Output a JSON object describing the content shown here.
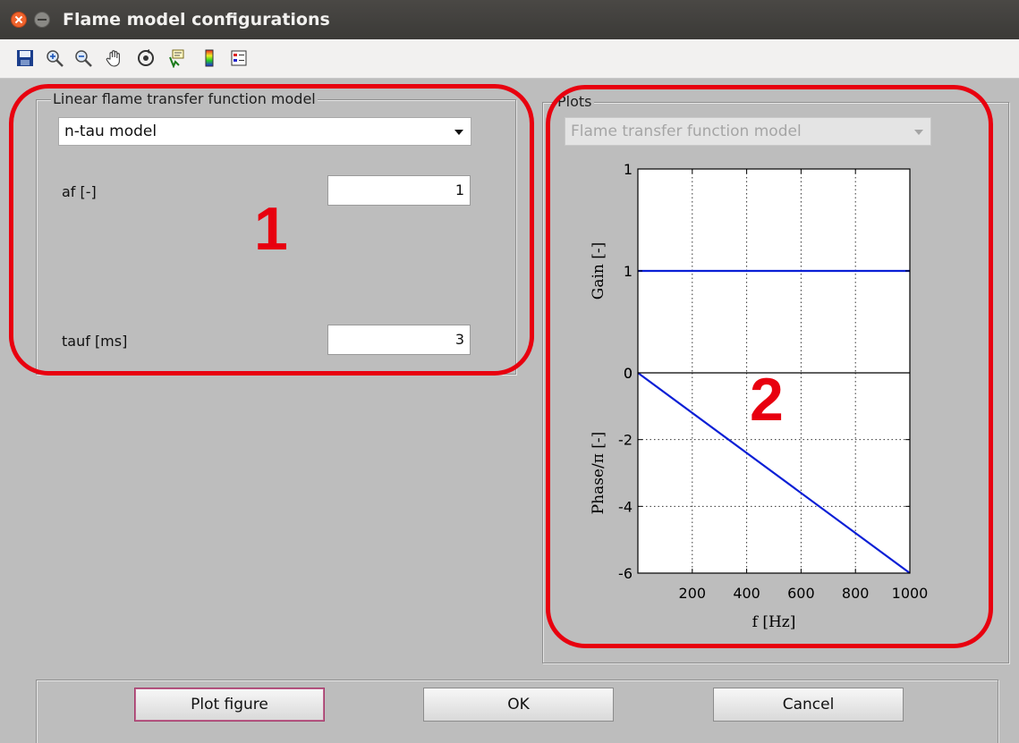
{
  "window": {
    "title": "Flame model configurations"
  },
  "toolbar": {
    "icons": [
      "save-icon",
      "zoom-in-icon",
      "zoom-out-icon",
      "pan-icon",
      "rotate-icon",
      "data-cursor-icon",
      "colorbar-icon",
      "legend-icon"
    ]
  },
  "left_panel": {
    "title": "Linear flame transfer function model",
    "model_select": {
      "value": "n-tau model"
    },
    "fields": [
      {
        "label": "af [-]",
        "value": "1"
      },
      {
        "label": "tauf [ms]",
        "value": "3"
      }
    ]
  },
  "right_panel": {
    "title": "Plots",
    "plot_select": {
      "value": "Flame transfer function model",
      "disabled": true
    }
  },
  "callouts": {
    "one": "1",
    "two": "2"
  },
  "buttons": {
    "plot_figure": "Plot figure",
    "ok": "OK",
    "cancel": "Cancel"
  },
  "chart_data": [
    {
      "type": "line",
      "ylabel": "Gain [-]",
      "xlim": [
        0,
        1000
      ],
      "ylim": [
        0,
        1
      ],
      "yticks": [
        {
          "value": 1,
          "label": "1"
        },
        {
          "value": 0.5,
          "label": "1"
        },
        {
          "value": 0,
          "label": "0"
        }
      ],
      "grid": true,
      "series": [
        {
          "x": [
            0,
            1000
          ],
          "y": [
            0.5,
            0.5
          ],
          "color": "#0a1fd6"
        }
      ]
    },
    {
      "type": "line",
      "ylabel": "Phase/π [-]",
      "xlabel": "f [Hz]",
      "xlim": [
        0,
        1000
      ],
      "ylim": [
        -6,
        0
      ],
      "xticks": [
        200,
        400,
        600,
        800,
        1000
      ],
      "yticks": [
        {
          "value": 0,
          "label": "0"
        },
        {
          "value": -2,
          "label": "-2"
        },
        {
          "value": -4,
          "label": "-4"
        },
        {
          "value": -6,
          "label": "-6"
        }
      ],
      "grid": true,
      "series": [
        {
          "x": [
            0,
            1000
          ],
          "y": [
            0,
            -6
          ],
          "color": "#0a1fd6"
        }
      ]
    }
  ]
}
